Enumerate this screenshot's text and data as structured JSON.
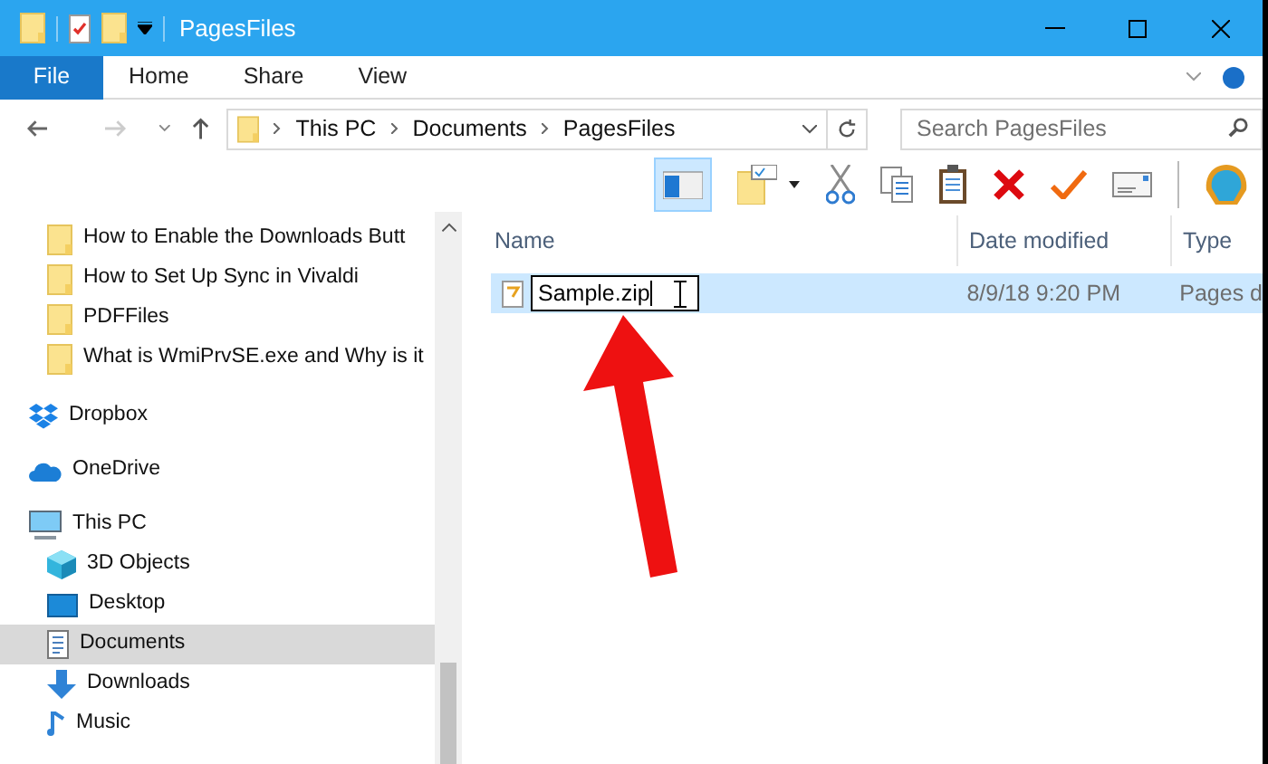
{
  "window": {
    "title": "PagesFiles"
  },
  "ribbon_tabs": [
    {
      "label": "File",
      "kind": "file"
    },
    {
      "label": "Home",
      "kind": "tab"
    },
    {
      "label": "Share",
      "kind": "tab"
    },
    {
      "label": "View",
      "kind": "tab"
    }
  ],
  "address": {
    "crumbs": [
      "This PC",
      "Documents",
      "PagesFiles"
    ]
  },
  "search": {
    "placeholder": "Search PagesFiles"
  },
  "sidebar": {
    "items": [
      {
        "kind": "group",
        "children": [
          {
            "label": "How to Enable the Downloads Butt",
            "kind": "folder",
            "selected": false
          },
          {
            "label": "How to Set Up Sync in Vivaldi",
            "kind": "folder",
            "selected": false
          },
          {
            "label": "PDFFiles",
            "kind": "folder",
            "selected": false
          },
          {
            "label": "What is WmiPrvSE.exe and Why is it",
            "kind": "folder",
            "selected": false
          }
        ]
      },
      {
        "label": "Dropbox",
        "kind": "dropbox",
        "selected": false
      },
      {
        "label": "OneDrive",
        "kind": "onedrive",
        "selected": false
      },
      {
        "label": "This PC",
        "kind": "pc",
        "selected": false,
        "children": [
          {
            "label": "3D Objects",
            "kind": "cube",
            "selected": false
          },
          {
            "label": "Desktop",
            "kind": "desktop",
            "selected": false
          },
          {
            "label": "Documents",
            "kind": "documents",
            "selected": true
          },
          {
            "label": "Downloads",
            "kind": "downloads",
            "selected": false
          },
          {
            "label": "Music",
            "kind": "music",
            "selected": false
          }
        ]
      }
    ]
  },
  "table": {
    "columns": [
      "Name",
      "Date modified",
      "Type"
    ],
    "rows": [
      {
        "name": "Sample.zip",
        "date": "8/9/18 9:20 PM",
        "type": "Pages d",
        "selected": true,
        "editing": true
      }
    ]
  }
}
